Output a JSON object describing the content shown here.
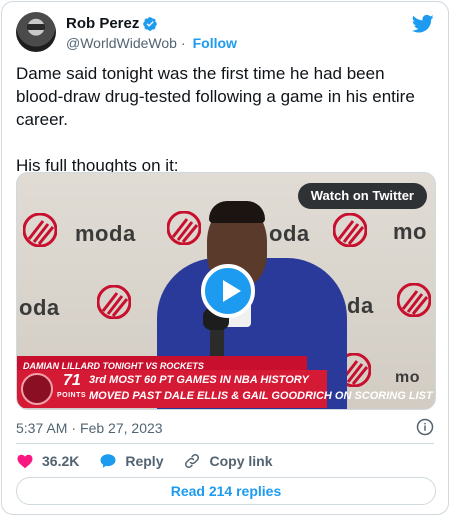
{
  "author": {
    "name": "Rob Perez",
    "handle": "@WorldWideWob",
    "follow_label": "Follow",
    "separator": "·"
  },
  "tweet": {
    "text": "Dame said tonight was the first time he had been blood-draw drug-tested following a game in his entire career.\n\nHis full thoughts on it:"
  },
  "media": {
    "watch_label": "Watch on Twitter",
    "backdrop_brand": "moda",
    "backdrop_brand_partial_left": "oda",
    "backdrop_brand_partial_right": "mo",
    "lower_third_header": "DAMIAN LILLARD TONIGHT VS ROCKETS",
    "lower_third_number": "71",
    "lower_third_unit": "POINTS",
    "lower_third_line1": "3rd MOST 60 PT GAMES IN NBA HISTORY",
    "lower_third_line2": "MOVED PAST DALE ELLIS & GAIL GOODRICH ON SCORING LIST"
  },
  "meta": {
    "time": "5:37 AM",
    "separator": "·",
    "date": "Feb 27, 2023"
  },
  "actions": {
    "like_count": "36.2K",
    "reply_label": "Reply",
    "copy_link_label": "Copy link"
  },
  "replies_button": "Read 214 replies",
  "colors": {
    "twitter_blue": "#1d9bf0",
    "like_pink": "#f91880",
    "blazers_red": "#c8102e",
    "text_secondary": "#536471"
  },
  "icons": [
    "verified-badge-icon",
    "twitter-bird-icon",
    "play-icon",
    "info-icon",
    "heart-icon",
    "reply-bubble-icon",
    "link-icon"
  ]
}
